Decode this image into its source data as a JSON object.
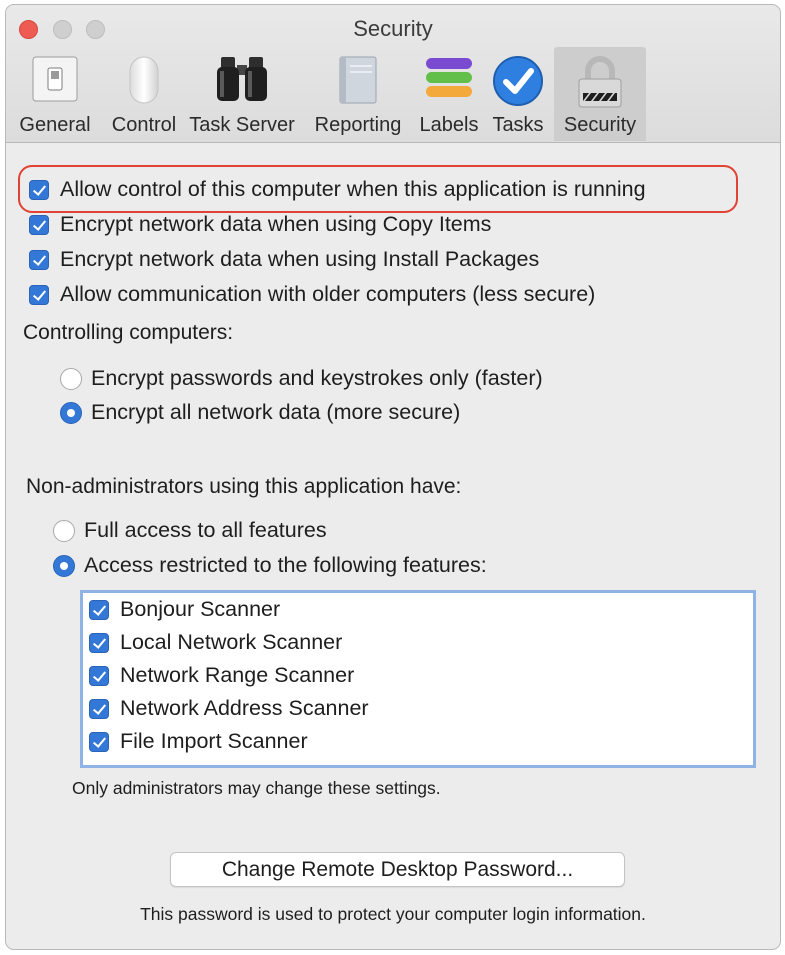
{
  "window": {
    "title": "Security"
  },
  "toolbar": {
    "tabs": [
      {
        "label": "General",
        "icon": "switch-icon"
      },
      {
        "label": "Control",
        "icon": "mouse-icon"
      },
      {
        "label": "Task Server",
        "icon": "binoculars-icon"
      },
      {
        "label": "Reporting",
        "icon": "report-book-icon"
      },
      {
        "label": "Labels",
        "icon": "labels-stack-icon"
      },
      {
        "label": "Tasks",
        "icon": "checkmark-circle-icon"
      },
      {
        "label": "Security",
        "icon": "padlock-icon"
      }
    ],
    "active_tab": "Security"
  },
  "options": {
    "allow_control": {
      "label": "Allow control of this computer when this application is running",
      "checked": true
    },
    "encrypt_copy": {
      "label": "Encrypt network data when using Copy Items",
      "checked": true
    },
    "encrypt_install": {
      "label": "Encrypt network data when using Install Packages",
      "checked": true
    },
    "allow_older": {
      "label": "Allow communication with older computers (less secure)",
      "checked": true
    }
  },
  "controlling": {
    "heading": "Controlling computers:",
    "passwords_only": {
      "label": "Encrypt passwords and keystrokes only (faster)",
      "selected": false
    },
    "all_data": {
      "label": "Encrypt all network data (more secure)",
      "selected": true
    }
  },
  "non_admin": {
    "heading": "Non-administrators using this application have:",
    "full_access": {
      "label": "Full access to all features",
      "selected": false
    },
    "restricted": {
      "label": "Access restricted to the following features:",
      "selected": true
    },
    "features": [
      {
        "label": "Bonjour Scanner",
        "checked": true
      },
      {
        "label": "Local Network Scanner",
        "checked": true
      },
      {
        "label": "Network Range Scanner",
        "checked": true
      },
      {
        "label": "Network Address Scanner",
        "checked": true
      },
      {
        "label": "File Import Scanner",
        "checked": true
      }
    ],
    "admin_note": "Only administrators may change these settings."
  },
  "password": {
    "button_label": "Change Remote Desktop Password...",
    "note": "This password is used to protect your computer login information."
  },
  "colors": {
    "accent": "#3478d7",
    "highlight_outline": "#e04333",
    "feature_box_border": "#8eb3e4"
  }
}
